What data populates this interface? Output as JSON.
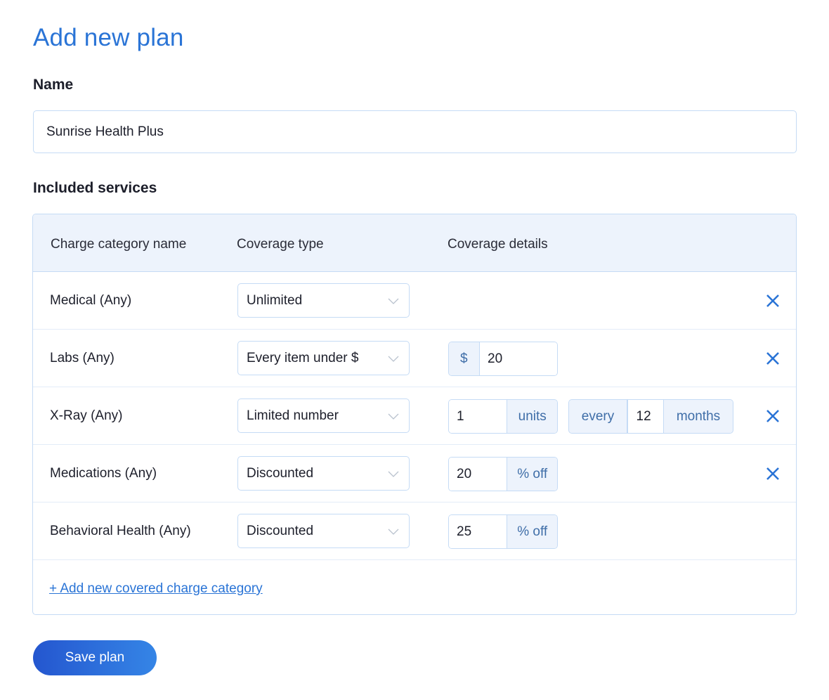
{
  "page": {
    "title": "Add new plan"
  },
  "name_section": {
    "label": "Name",
    "value": "Sunrise Health Plus"
  },
  "services": {
    "label": "Included services",
    "headers": [
      "Charge category name",
      "Coverage type",
      "Coverage details"
    ],
    "rows": [
      {
        "category": "Medical (Any)",
        "coverage_type": "Unlimited",
        "removable": true
      },
      {
        "category": "Labs (Any)",
        "coverage_type": "Every item under $",
        "prefix": "$",
        "amount": "20",
        "removable": true
      },
      {
        "category": "X-Ray (Any)",
        "coverage_type": "Limited number",
        "units": "1",
        "units_label": "units",
        "every_label": "every",
        "period": "12",
        "period_label": "months",
        "removable": true
      },
      {
        "category": "Medications (Any)",
        "coverage_type": "Discounted",
        "percent": "20",
        "percent_label": "% off",
        "removable": true
      },
      {
        "category": "Behavioral Health (Any)",
        "coverage_type": "Discounted",
        "percent": "25",
        "percent_label": "% off",
        "removable": false
      }
    ],
    "add_link": "+ Add new covered charge category"
  },
  "actions": {
    "save_label": "Save plan"
  },
  "icons": {
    "chevron": "chevron-down-icon",
    "remove": "close-icon"
  },
  "colors": {
    "accent": "#2a74d6",
    "border": "#c5dbf5",
    "header_bg": "#edf3fc"
  }
}
